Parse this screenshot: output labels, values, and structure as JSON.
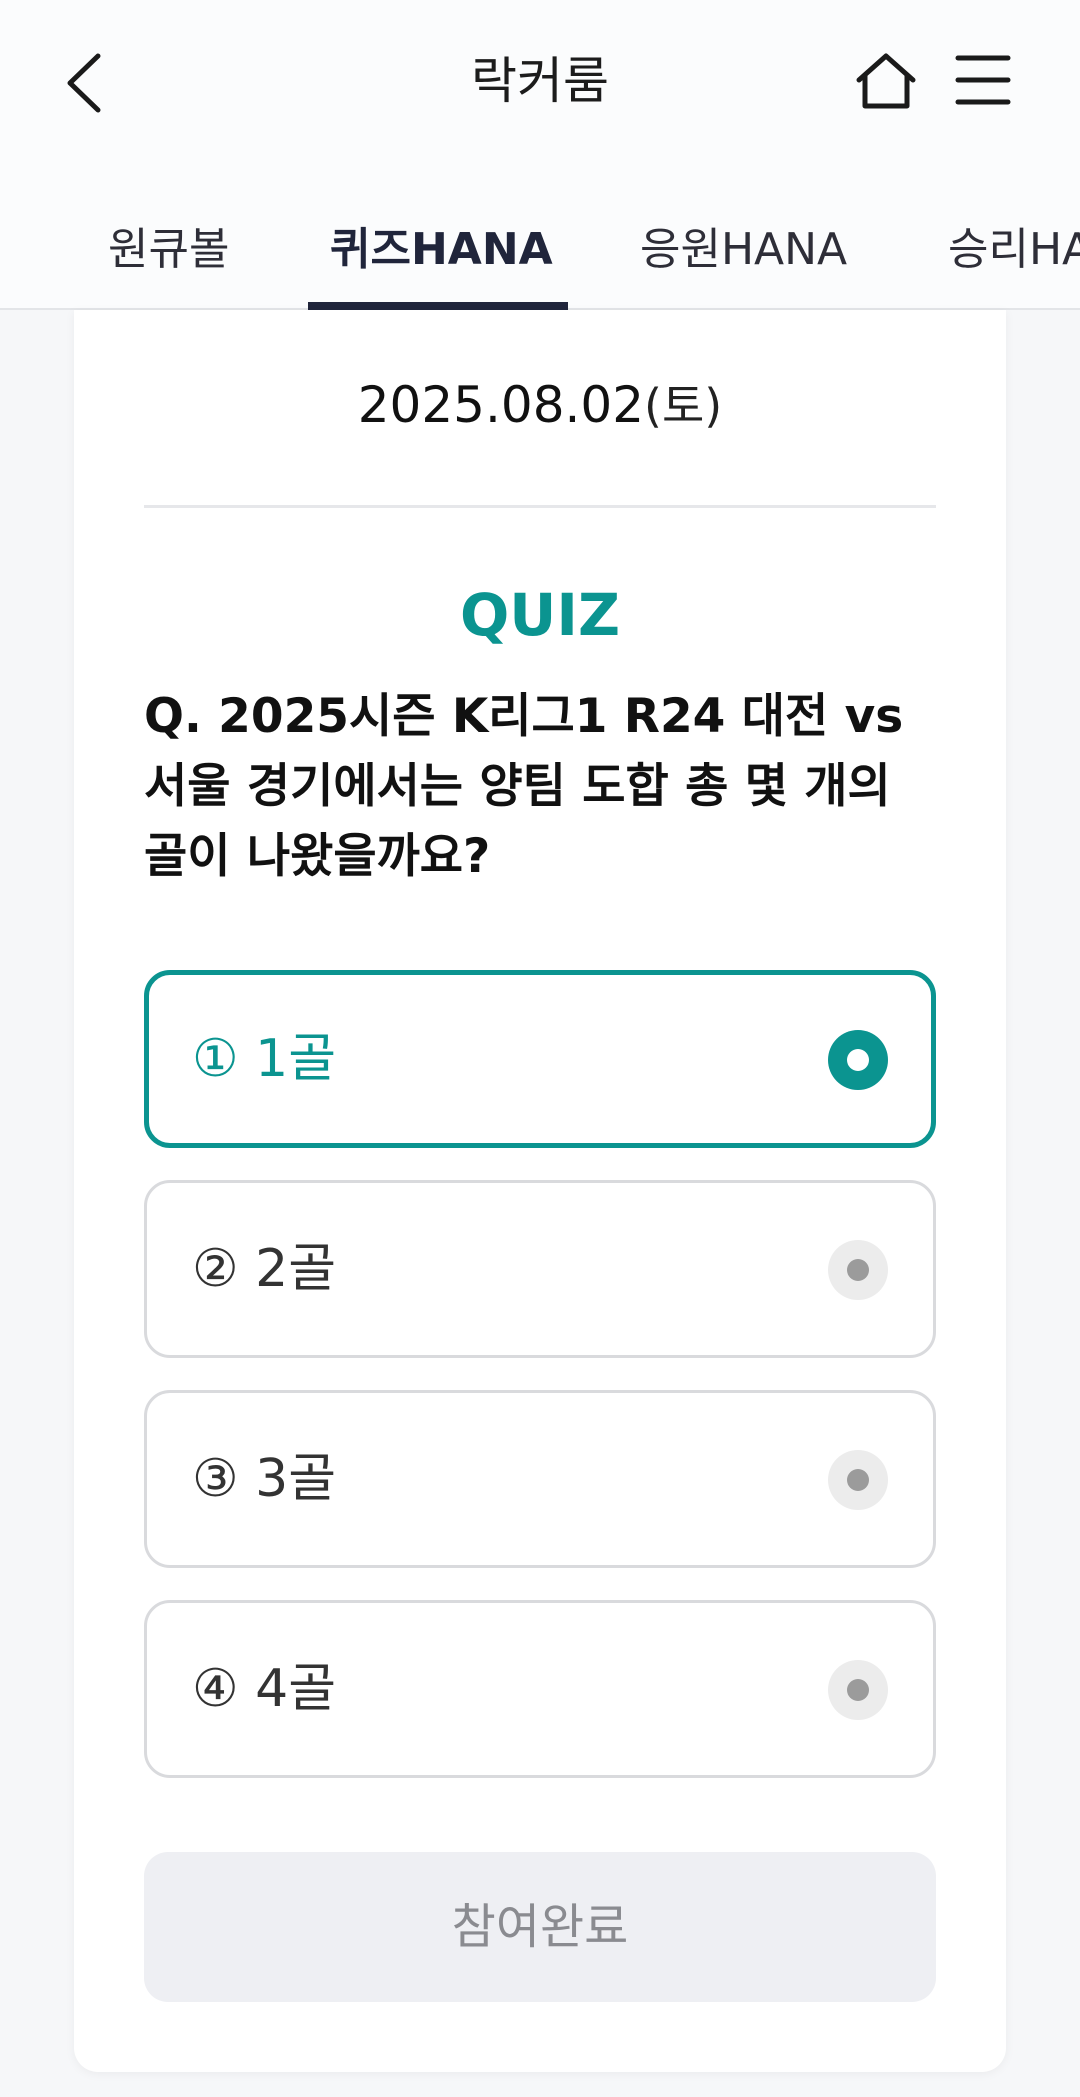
{
  "header": {
    "title": "락커룸",
    "back_icon": "chevron-left-icon",
    "home_icon": "home-icon",
    "menu_icon": "hamburger-menu-icon"
  },
  "tabs": [
    {
      "label": "원큐볼",
      "active": false
    },
    {
      "label": "퀴즈HANA",
      "active": true
    },
    {
      "label": "응원HANA",
      "active": false
    },
    {
      "label": "승리HANA",
      "active": false
    }
  ],
  "quiz": {
    "date": "2025.08.02",
    "day": "(토)",
    "label": "QUIZ",
    "question": "Q. 2025시즌 K리그1 R24 대전 vs 서울 경기에서는 양팀 도합 총 몇 개의 골이 나왔을까요?",
    "options": [
      {
        "label": "① 1골",
        "selected": true
      },
      {
        "label": "② 2골",
        "selected": false
      },
      {
        "label": "③ 3골",
        "selected": false
      },
      {
        "label": "④ 4골",
        "selected": false
      }
    ],
    "submit_label": "참여완료"
  },
  "colors": {
    "accent": "#0b9490",
    "tab_active": "#20253b",
    "button_disabled_bg": "#eeeff3"
  }
}
